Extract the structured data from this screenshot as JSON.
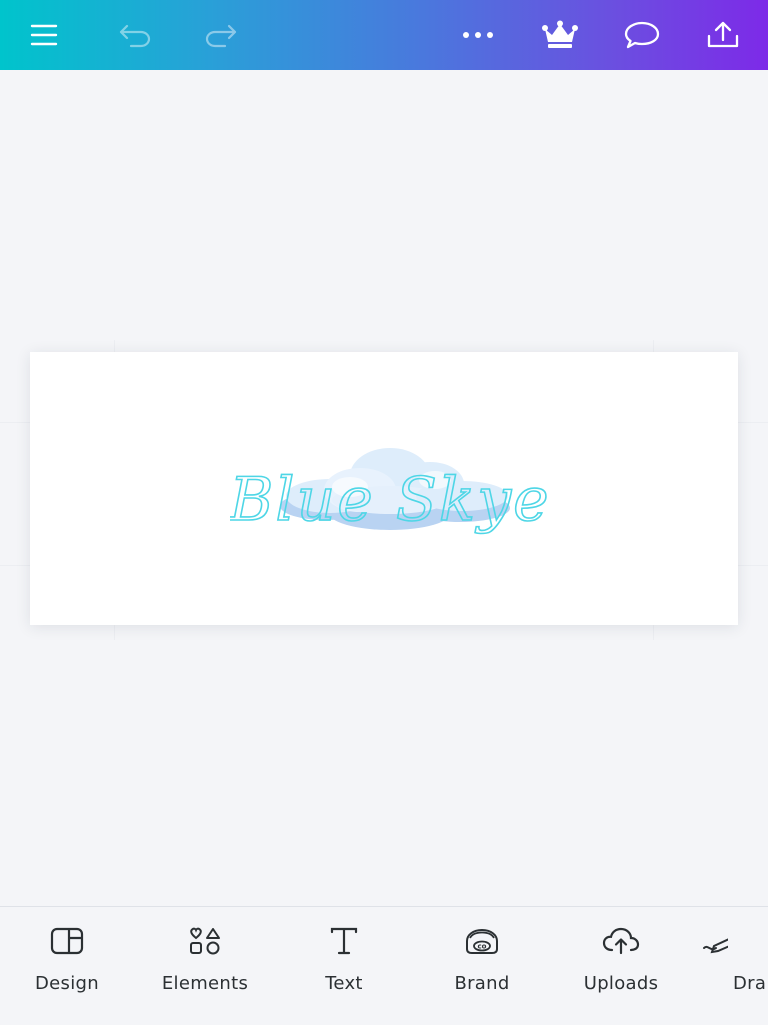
{
  "topbar": {
    "icons": [
      "menu-icon",
      "undo-icon",
      "redo-icon",
      "more-icon",
      "crown-icon",
      "comment-icon",
      "share-upload-icon"
    ],
    "gradient": [
      "#00c4cc",
      "#7d2ae8"
    ]
  },
  "canvas": {
    "logo_text": "Blue Skye",
    "logo_text_color": "#4ed6e6",
    "cloud_color": "#b9d3f2"
  },
  "bottom_toolbar": {
    "items": [
      {
        "label": "Design",
        "icon": "design-icon"
      },
      {
        "label": "Elements",
        "icon": "elements-icon"
      },
      {
        "label": "Text",
        "icon": "text-icon"
      },
      {
        "label": "Brand",
        "icon": "brand-icon"
      },
      {
        "label": "Uploads",
        "icon": "uploads-icon"
      },
      {
        "label": "Dra",
        "icon": "draw-icon"
      }
    ]
  }
}
